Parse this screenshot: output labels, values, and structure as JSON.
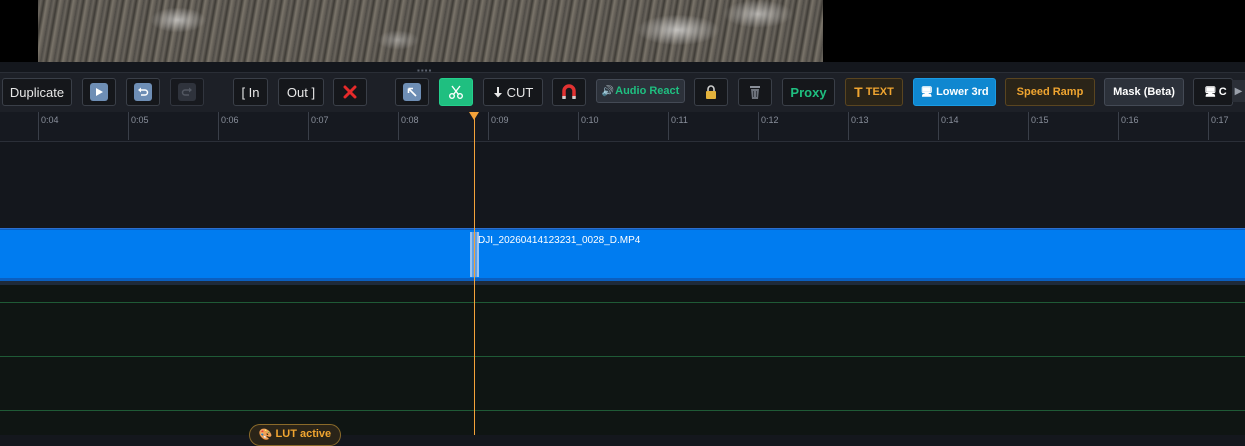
{
  "toolbar": {
    "duplicate": "Duplicate",
    "in": "[ In",
    "out": "Out ]",
    "cut": "CUT",
    "audio_react": "Audio React",
    "proxy": "Proxy",
    "text": "TEXT",
    "lower3rd": "Lower 3rd",
    "speed_ramp": "Speed Ramp",
    "mask": "Mask (Beta)",
    "partial": "C"
  },
  "ruler": {
    "ticks": [
      "0:04",
      "0:05",
      "0:06",
      "0:07",
      "0:08",
      "0:09",
      "0:10",
      "0:11",
      "0:12",
      "0:13",
      "0:14",
      "0:15",
      "0:16",
      "0:17"
    ]
  },
  "clip": {
    "filename": "DJI_20260414123231_0028_D.MP4"
  },
  "badge": {
    "lut": "LUT active"
  },
  "colors": {
    "accent_green": "#1fbf80",
    "clip_blue": "#007cf0",
    "playhead": "#f3a23a",
    "proxy_text": "#1fbf80",
    "text_btn": "#f0a530"
  }
}
